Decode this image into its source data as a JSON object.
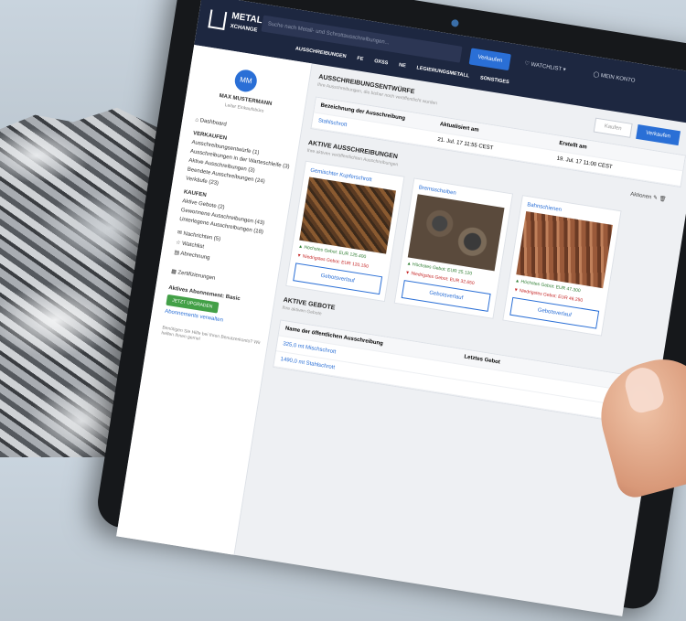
{
  "app": {
    "logo_line1": "METAL",
    "logo_line2": "XCHANGE"
  },
  "topbar": {
    "search_placeholder": "Suche nach Metall- und Schrottausschreibungen...",
    "sell_button": "Verkaufen",
    "watchlist": "WATCHLIST",
    "account": "MEIN KONTO"
  },
  "nav": [
    "AUSSCHREIBUNGEN",
    "FE",
    "OXSS",
    "NE",
    "LEGIERUNGSMETALL",
    "SONSTIGES"
  ],
  "user": {
    "initials": "MM",
    "name": "MAX MUSTERMANN",
    "role": "Leiter Einkaufsbüro"
  },
  "sidebar": {
    "dashboard": "Dashboard",
    "sell_title": "VERKAUFEN",
    "sell_items": [
      "Ausschreibungsentwürfe (1)",
      "Ausschreibungen in der Warteschleife (3)",
      "Aktive Ausschreibungen (3)",
      "Beendete Ausschreibungen (24)",
      "Verkäufe (23)"
    ],
    "buy_title": "KAUFEN",
    "buy_items": [
      "Aktive Gebote (2)",
      "Gewonnene Ausschreibungen (43)",
      "Unterlegene Ausschreibungen (18)"
    ],
    "extra_items": [
      "Nachrichten (5)",
      "Watchlist",
      "Abrechnung"
    ],
    "certs": "Zertifizierungen",
    "subscription": "Aktives Abonnement: Basic",
    "upgrade": "JETZT UPGRADEN",
    "manage": "Abonnements verwalten",
    "help": "Benötigen Sie Hilfe bei Ihren Benutzerkonto? Wir helfen Ihnen gerne!"
  },
  "drafts": {
    "title": "AUSSCHREIBUNGSENTWÜRFE",
    "subtitle": "Ihre Ausschreibungen, die bisher noch veröffentlicht wurden",
    "buy_button": "Kaufen",
    "sell_button": "Verkaufen",
    "cols": [
      "Bezeichnung der Ausschreibung",
      "Aktualisiert am",
      "Erstellt am"
    ],
    "row": [
      "Stahlschrott",
      "21. Jul. 17 11:55 CEST",
      "19. Jul. 17 11:00 CEST"
    ]
  },
  "active": {
    "title": "AKTIVE AUSSCHREIBUNGEN",
    "subtitle": "Ihre aktiven veröffentlichten Ausschreibungen",
    "actions": "Aktionen",
    "cards": [
      {
        "title": "Gemischter Kupferschrott",
        "high": "Höchstes Gebot: EUR 125.400",
        "low": "Niedrigstes Gebot: EUR 120.150",
        "button": "Gebotsverlauf"
      },
      {
        "title": "Bremsscheiben",
        "high": "Höchstes Gebot: EUR 25.120",
        "low": "Niedrigstes Gebot: EUR 32.650",
        "button": "Gebotsverlauf"
      },
      {
        "title": "Bahnschienen",
        "high": "Höchstes Gebot: EUR 47.300",
        "low": "Niedrigstes Gebot: EUR 46.250",
        "button": "Gebotsverlauf"
      }
    ]
  },
  "bids": {
    "title": "AKTIVE GEBOTE",
    "subtitle": "Ihre aktiven Gebote",
    "col1": "Name der öffentlichen Ausschreibung",
    "col2": "Letztes Gebot",
    "rows": [
      "325,0 mt Mischschrott",
      "1490,0 mt Stahlschrott"
    ]
  }
}
